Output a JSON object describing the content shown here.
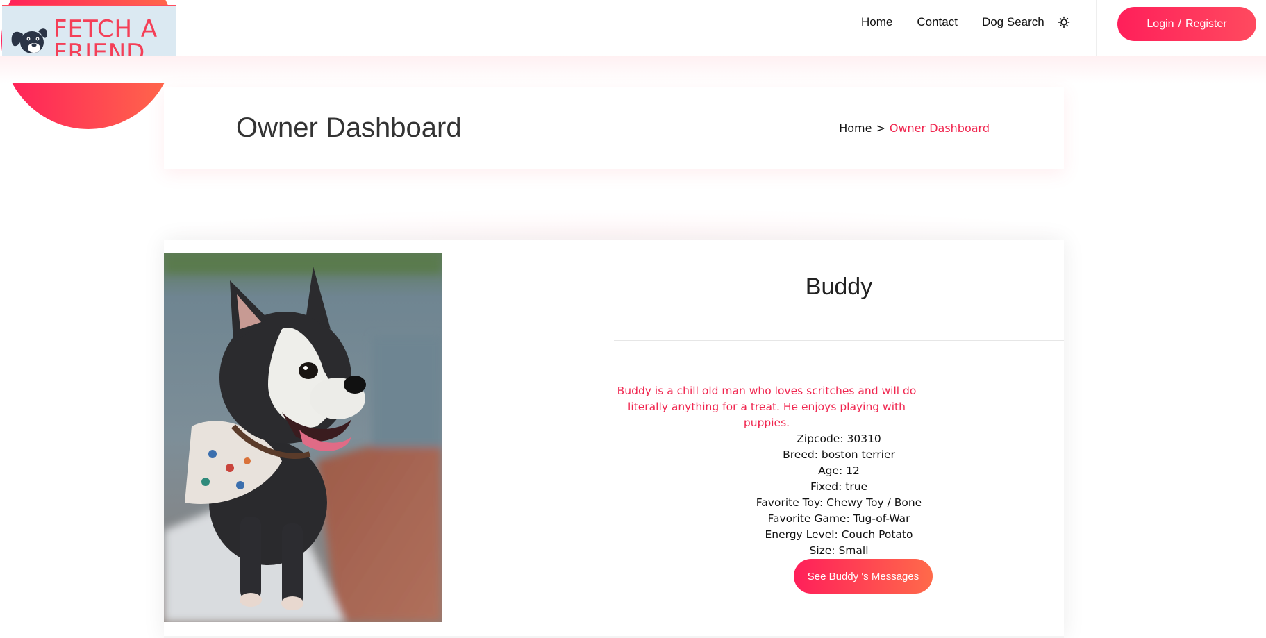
{
  "brand": {
    "logo_line1": "FETCH A",
    "logo_line2": "FRIEND"
  },
  "nav": {
    "items": [
      {
        "label": "Home"
      },
      {
        "label": "Contact"
      },
      {
        "label": "Dog Search"
      }
    ],
    "theme_icon": "sun-icon",
    "login_label": "Login",
    "login_sep": "/",
    "register_label": "Register"
  },
  "banner": {
    "title": "Owner Dashboard",
    "breadcrumb": {
      "home": "Home",
      "separator": ">",
      "current": "Owner Dashboard"
    }
  },
  "dog": {
    "name": "Buddy",
    "description": "Buddy is a chill old man who loves scritches and will do literally anything for a treat. He enjoys playing with puppies.",
    "zipcode": "Zipcode: 30310",
    "breed": "Breed: boston terrier",
    "age": "Age: 12",
    "fixed": "Fixed: true",
    "favorite_toy": "Favorite Toy: Chewy Toy / Bone",
    "favorite_game": "Favorite Game: Tug-of-War",
    "energy_level": "Energy Level: Couch Potato",
    "size": "Size: Small",
    "messages_button": "See Buddy 's Messages"
  },
  "colors": {
    "accent": "#f0264f",
    "accent_gradient_end": "#ff6a4a",
    "logo_bg": "#dbe9f2"
  }
}
